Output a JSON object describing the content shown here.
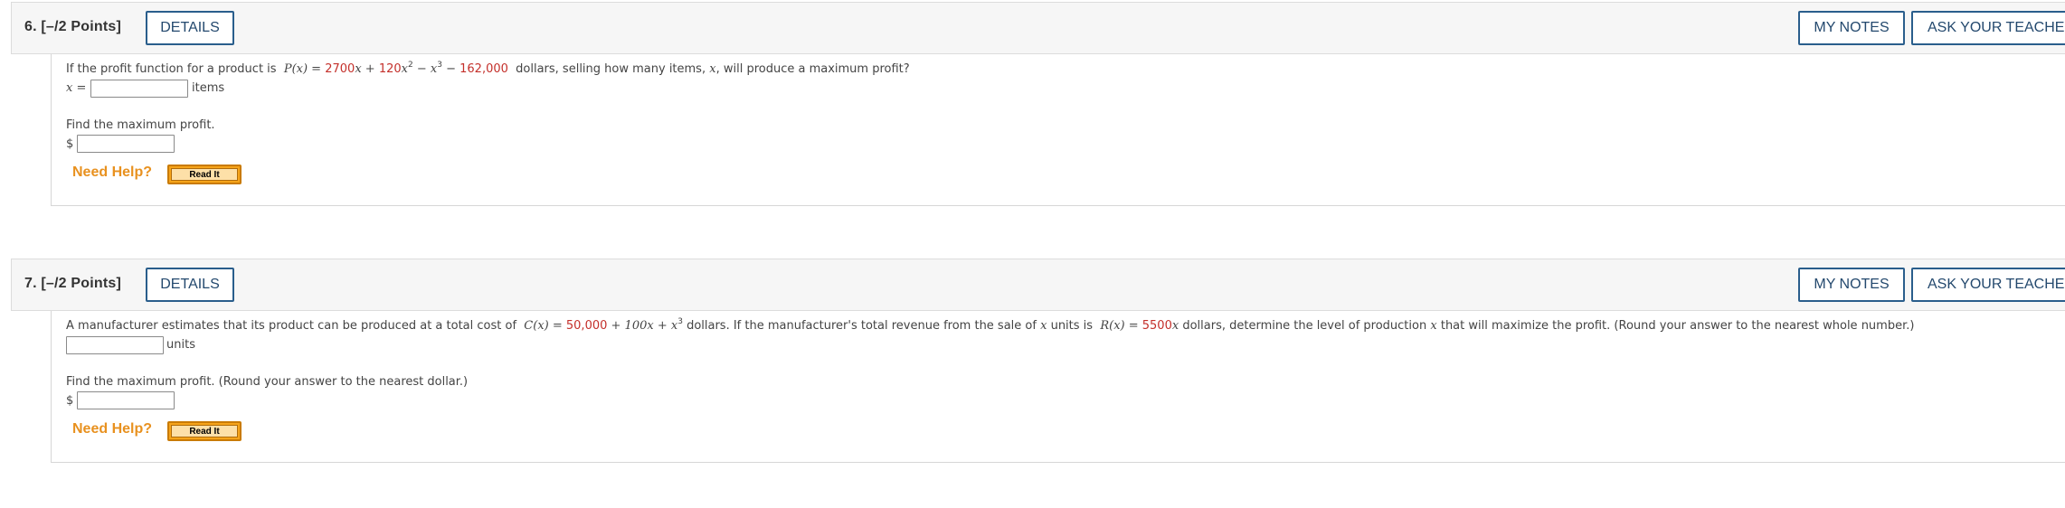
{
  "questions": [
    {
      "number": "6.",
      "points": "[–/2 Points]",
      "details_label": "DETAILS",
      "my_notes_label": "MY NOTES",
      "ask_teacher_label": "ASK YOUR TEACHER",
      "prompt_lead": "If the profit function for a product is",
      "prompt_tail": "dollars, selling how many items,",
      "prompt_var": "x",
      "prompt_end": ", will produce a maximum profit?",
      "answer1_prefix": "x =",
      "answer1_unit": "items",
      "answer1_value": "",
      "sub_prompt": "Find the maximum profit.",
      "answer2_prefix": "$",
      "answer2_value": "",
      "help_label": "Need Help?",
      "read_it_label": "Read It"
    },
    {
      "number": "7.",
      "points": "[–/2 Points]",
      "details_label": "DETAILS",
      "my_notes_label": "MY NOTES",
      "ask_teacher_label": "ASK YOUR TEACHER",
      "prompt_lead": "A manufacturer estimates that its product can be produced at a total cost of",
      "prompt_mid": "dollars.  If the manufacturer's total revenue from the sale of",
      "prompt_mid2": "units is",
      "prompt_tail": "dollars,  determine the level of production",
      "prompt_end": "that will maximize the profit. (Round your answer to the nearest whole number.)",
      "answer1_unit": "units",
      "answer1_value": "",
      "sub_prompt": "Find the maximum profit. (Round your answer to the nearest dollar.)",
      "answer2_prefix": "$",
      "answer2_value": "",
      "help_label": "Need Help?",
      "read_it_label": "Read It"
    }
  ],
  "math": {
    "q6_lhs": "P(x) =",
    "q6_c1": "2700",
    "q6_t1": "x + ",
    "q6_c2": "120",
    "q6_t2": "x",
    "q6_t3": " − x",
    "q6_t4": " − ",
    "q6_c3": "162,000",
    "q7_cost_lhs": "C(x) =",
    "q7_c1": "50,000",
    "q7_t1": " + 100x + x",
    "q7_rev_lhs": "R(x) =",
    "q7_c2": "5500",
    "q7_t2": "x",
    "exp2": "2",
    "exp3": "3",
    "var_x": "x"
  },
  "colors": {
    "accent_button": "#2a5e8c",
    "given_value": "#c4302b",
    "help_text": "#e8911f",
    "read_it_button": "#f6a41a"
  }
}
